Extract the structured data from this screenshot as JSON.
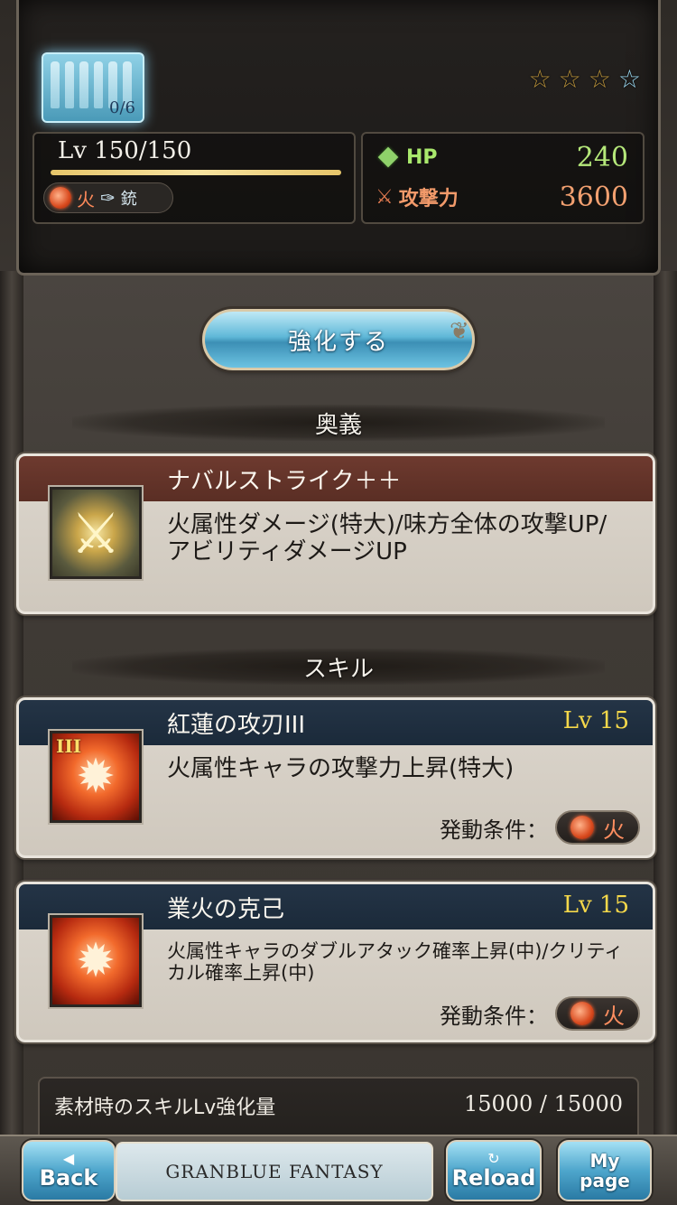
{
  "header": {
    "uncap_count": "0/6",
    "stars": [
      "☆",
      "☆",
      "☆",
      "☆"
    ],
    "level": "Lv 150/150",
    "element_label": "火",
    "weapon_type_label": "銃",
    "hp_label": "HP",
    "hp_value": "240",
    "atk_label": "攻撃力",
    "atk_value": "3600"
  },
  "upgrade_button": "強化する",
  "ougi_section": {
    "header": "奥義",
    "name": "ナバルストライク＋＋",
    "description": "火属性ダメージ(特大)/味方全体の攻撃UP/アビリティダメージUP"
  },
  "skill_section": {
    "header": "スキル",
    "skills": [
      {
        "name": "紅蓮の攻刃III",
        "level": "Lv 15",
        "description": "火属性キャラの攻撃力上昇(特大)",
        "condition_label": "発動条件：",
        "condition_value": "火",
        "icon_tag": "III"
      },
      {
        "name": "業火の克己",
        "level": "Lv 15",
        "description": "火属性キャラのダブルアタック確率上昇(中)/クリティカル確率上昇(中)",
        "condition_label": "発動条件：",
        "condition_value": "火"
      }
    ]
  },
  "material": {
    "label": "素材時のスキルLv強化量",
    "value": "15000 / 15000"
  },
  "bottom_nav": {
    "back": "Back",
    "logo": "GRANBLUE FANTASY",
    "reload": "Reload",
    "mypage": "My page"
  },
  "colors": {
    "accent_blue": "#5fb8d8",
    "fire": "#d94a1e",
    "hp_green": "#a9e86c",
    "atk_orange": "#f29a6a",
    "skill_lv_gold": "#f5d84a"
  }
}
